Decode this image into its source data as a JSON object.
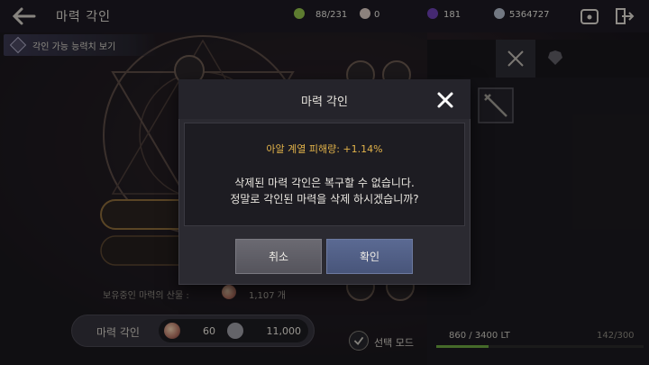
{
  "header": {
    "title": "마력 각인",
    "stats": [
      {
        "name": "energy",
        "value": "88/231",
        "color": "#8fbf4a"
      },
      {
        "name": "pearl",
        "value": "0",
        "color": "#d8c8c0"
      },
      {
        "name": "purple-gem",
        "value": "181",
        "color": "#6a3fb0"
      },
      {
        "name": "silver",
        "value": "5364727",
        "color": "#b0b8c8"
      }
    ]
  },
  "ability_chip": {
    "label": "각인 가능 능력치 보기"
  },
  "equipment": {
    "lt": "860 / 3400 LT",
    "slots": "142/300",
    "lt_fraction": 0.253
  },
  "owned": {
    "label": "보유중인 마력의 산물 :",
    "count": "1,107 개"
  },
  "engrave": {
    "label": "마력 각인",
    "cost_a": "60",
    "cost_b": "11,000"
  },
  "select_mode": {
    "label": "선택 모드"
  },
  "modal": {
    "title": "마력 각인",
    "stat": "아알 계열 피해량: +1.14%",
    "message_line1": "삭제된 마력 각인은 복구할 수 없습니다.",
    "message_line2": "정말로 각인된 마력을 삭제 하시겠습니까?",
    "cancel": "취소",
    "confirm": "확인"
  },
  "colors": {
    "accent": "#e1b24a",
    "confirm": "#4f5d86",
    "cancel": "#5f5e66"
  }
}
